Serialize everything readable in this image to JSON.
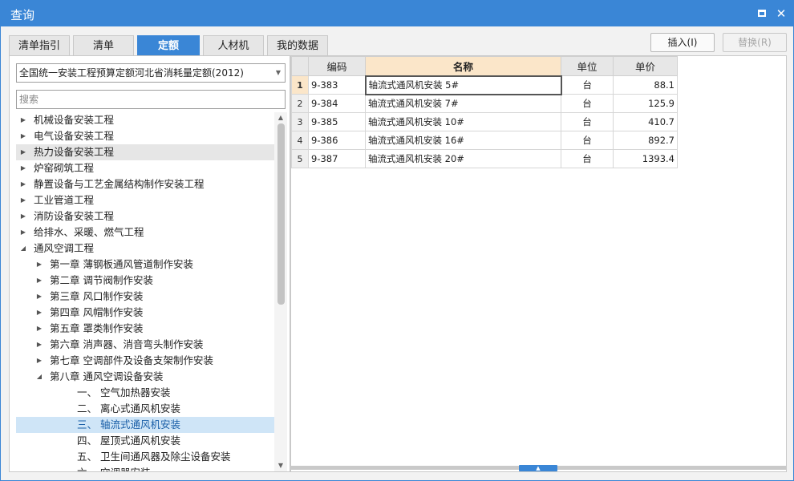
{
  "window": {
    "title": "查询"
  },
  "tabs": [
    {
      "label": "清单指引"
    },
    {
      "label": "清单"
    },
    {
      "label": "定额",
      "active": true
    },
    {
      "label": "人材机"
    },
    {
      "label": "我的数据"
    }
  ],
  "toolbar": {
    "insert_label": "插入(I)",
    "replace_label": "替换(R)"
  },
  "left": {
    "library_selected": "全国统一安装工程预算定额河北省消耗量定额(2012)",
    "search_placeholder": "搜索",
    "tree": [
      {
        "label": "机械设备安装工程",
        "level": 0,
        "state": "collapsed"
      },
      {
        "label": "电气设备安装工程",
        "level": 0,
        "state": "collapsed"
      },
      {
        "label": "热力设备安装工程",
        "level": 0,
        "state": "collapsed",
        "hover": true
      },
      {
        "label": "炉窑砌筑工程",
        "level": 0,
        "state": "collapsed"
      },
      {
        "label": "静置设备与工艺金属结构制作安装工程",
        "level": 0,
        "state": "collapsed"
      },
      {
        "label": "工业管道工程",
        "level": 0,
        "state": "collapsed"
      },
      {
        "label": "消防设备安装工程",
        "level": 0,
        "state": "collapsed"
      },
      {
        "label": "给排水、采暖、燃气工程",
        "level": 0,
        "state": "collapsed"
      },
      {
        "label": "通风空调工程",
        "level": 0,
        "state": "expanded"
      },
      {
        "label": "第一章  薄钢板通风管道制作安装",
        "level": 1,
        "state": "collapsed"
      },
      {
        "label": "第二章  调节阀制作安装",
        "level": 1,
        "state": "collapsed"
      },
      {
        "label": "第三章  风口制作安装",
        "level": 1,
        "state": "collapsed"
      },
      {
        "label": "第四章  风帽制作安装",
        "level": 1,
        "state": "collapsed"
      },
      {
        "label": "第五章  罩类制作安装",
        "level": 1,
        "state": "collapsed"
      },
      {
        "label": "第六章  消声器、消音弯头制作安装",
        "level": 1,
        "state": "collapsed"
      },
      {
        "label": "第七章  空调部件及设备支架制作安装",
        "level": 1,
        "state": "collapsed"
      },
      {
        "label": "第八章  通风空调设备安装",
        "level": 1,
        "state": "expanded"
      },
      {
        "label": "一、  空气加热器安装",
        "level": 2,
        "state": "leaf"
      },
      {
        "label": "二、  离心式通风机安装",
        "level": 2,
        "state": "leaf"
      },
      {
        "label": "三、  轴流式通风机安装",
        "level": 2,
        "state": "leaf",
        "selected": true
      },
      {
        "label": "四、  屋顶式通风机安装",
        "level": 2,
        "state": "leaf"
      },
      {
        "label": "五、  卫生间通风器及除尘设备安装",
        "level": 2,
        "state": "leaf"
      },
      {
        "label": "六、  空调器安装",
        "level": 2,
        "state": "leaf"
      }
    ]
  },
  "grid": {
    "columns": [
      "编码",
      "名称",
      "单位",
      "单价"
    ],
    "rows": [
      {
        "index": "1",
        "code": "9-383",
        "name": "轴流式通风机安装  5#",
        "unit": "台",
        "price": "88.1"
      },
      {
        "index": "2",
        "code": "9-384",
        "name": "轴流式通风机安装  7#",
        "unit": "台",
        "price": "125.9"
      },
      {
        "index": "3",
        "code": "9-385",
        "name": "轴流式通风机安装  10#",
        "unit": "台",
        "price": "410.7"
      },
      {
        "index": "4",
        "code": "9-386",
        "name": "轴流式通风机安装  16#",
        "unit": "台",
        "price": "892.7"
      },
      {
        "index": "5",
        "code": "9-387",
        "name": "轴流式通风机安装  20#",
        "unit": "台",
        "price": "1393.4"
      }
    ]
  }
}
